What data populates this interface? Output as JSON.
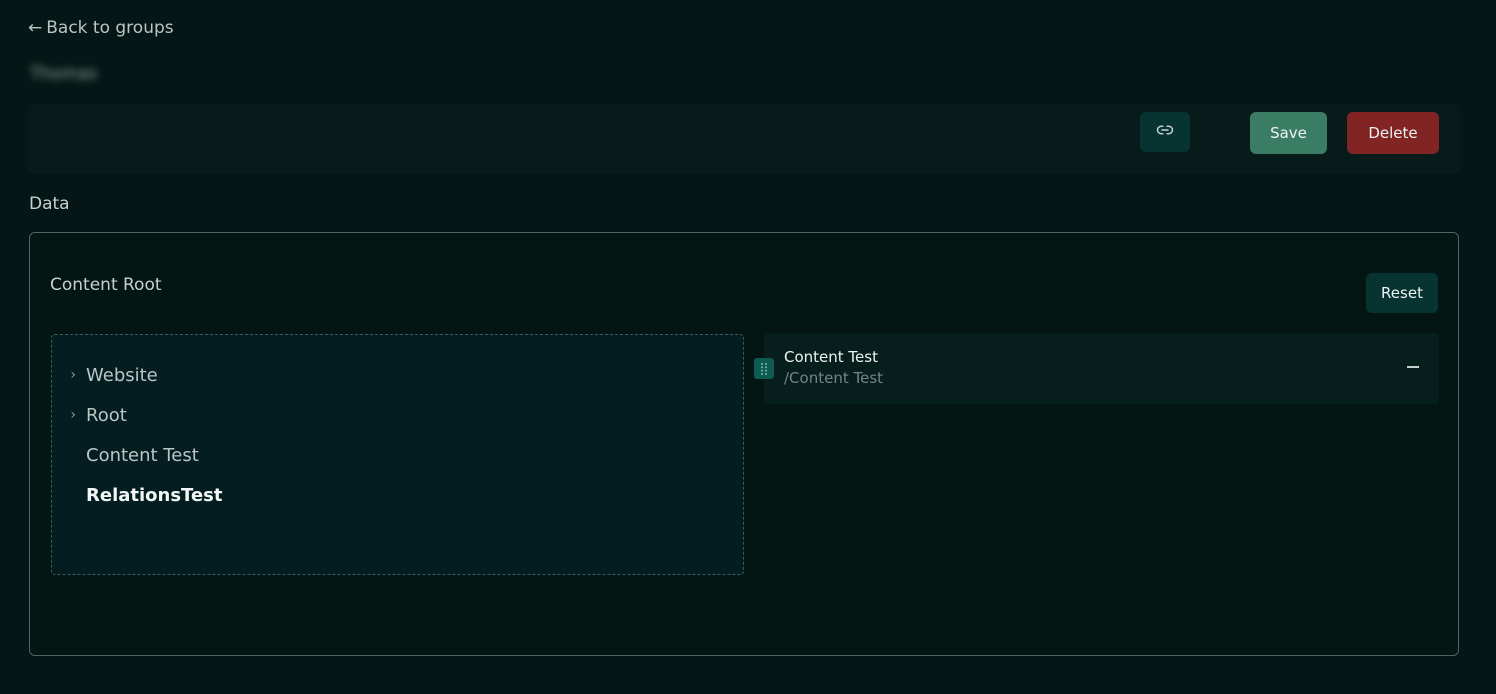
{
  "nav": {
    "back_label": "Back to groups",
    "back_arrow": "←"
  },
  "group": {
    "name": "Thomas"
  },
  "actions": {
    "link_icon": "link-icon",
    "save_label": "Save",
    "delete_label": "Delete",
    "colors": {
      "save": "#3a7d64",
      "delete": "#822424"
    }
  },
  "section": {
    "label": "Data"
  },
  "content_root": {
    "label": "Content Root",
    "reset_label": "Reset",
    "tree": [
      {
        "label": "Website",
        "expandable": true
      },
      {
        "label": "Root",
        "expandable": true
      },
      {
        "label": "Content Test",
        "expandable": false
      },
      {
        "label": "RelationsTest",
        "expandable": false
      }
    ],
    "selected": [
      {
        "title": "Content Test",
        "path": "/Content Test"
      }
    ]
  }
}
